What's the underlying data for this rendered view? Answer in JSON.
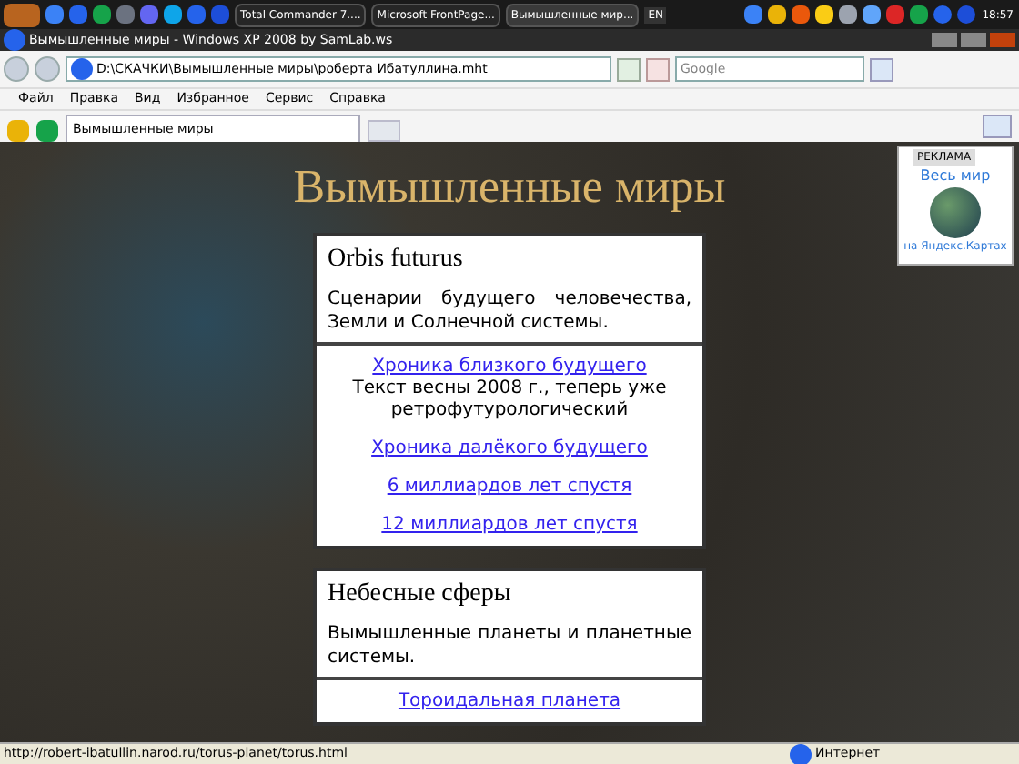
{
  "taskbar": {
    "tasks": [
      {
        "label": "Total Commander 7....",
        "selected": false
      },
      {
        "label": "Microsoft FrontPage...",
        "selected": false
      },
      {
        "label": "Вымышленные мир...",
        "selected": true
      }
    ],
    "language": "EN",
    "clock": "18:57"
  },
  "window": {
    "title": "Вымышленные миры - Windows XP 2008 by SamLab.ws"
  },
  "address_bar": {
    "value": "D:\\СКАЧКИ\\Вымышленные миры\\роберта Ибатуллина.mht"
  },
  "search": {
    "placeholder": "Google"
  },
  "menu": [
    "Файл",
    "Правка",
    "Вид",
    "Избранное",
    "Сервис",
    "Справка"
  ],
  "tabs": [
    {
      "label": "Вымышленные миры",
      "selected": true
    }
  ],
  "page": {
    "title": "Вымышленные миры",
    "sections": [
      {
        "heading": "Orbis futurus",
        "description": "Сценарии будущего человечества, Земли и Солнечной системы.",
        "links": [
          {
            "label": "Хроника близкого будущего",
            "note": "Текст весны 2008 г., теперь уже ретрофутурологический"
          },
          {
            "label": "Хроника далёкого будущего"
          },
          {
            "label": "6 миллиардов лет спустя"
          },
          {
            "label": "12 миллиардов лет спустя"
          }
        ]
      },
      {
        "heading": "Небесные сферы",
        "description": "Вымышленные планеты и планетные системы.",
        "links": [
          {
            "label": "Тороидальная планета"
          }
        ]
      }
    ]
  },
  "ad": {
    "badge": "РЕКЛАМА",
    "title": "Весь мир",
    "caption": "на Яндекс.Картах"
  },
  "status_bar": {
    "url": "http://robert-ibatullin.narod.ru/torus-planet/torus.html",
    "zone": "Интернет"
  }
}
